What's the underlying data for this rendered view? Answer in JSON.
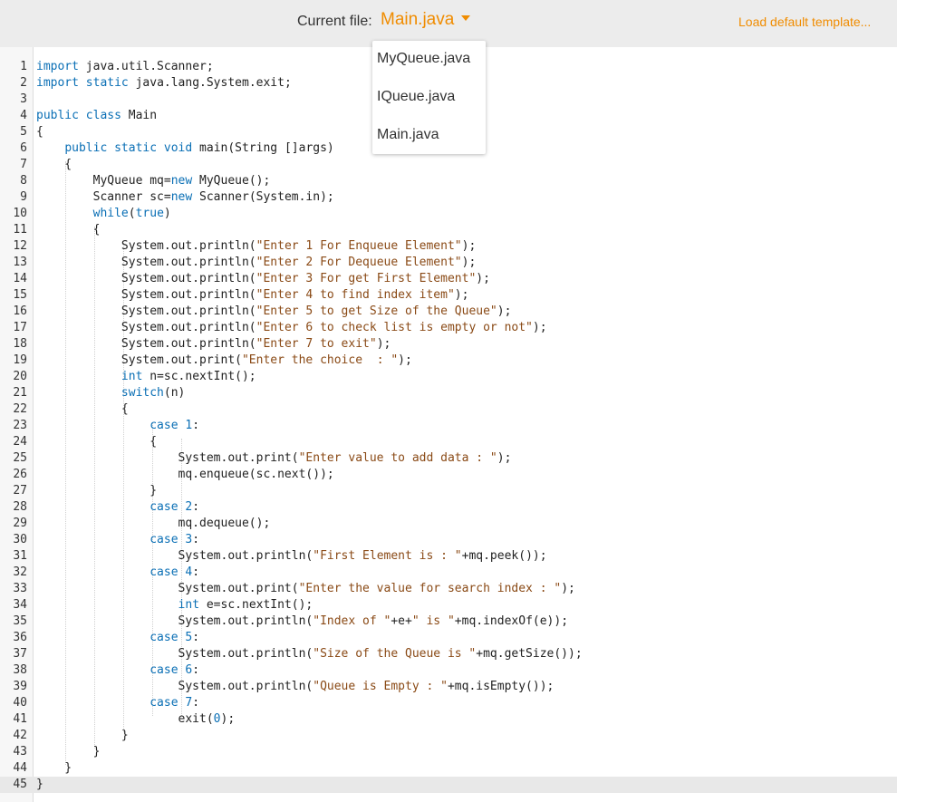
{
  "header": {
    "current_file_label": "Current file:",
    "current_file": "Main.java",
    "load_template": "Load default template..."
  },
  "file_menu": {
    "items": [
      "MyQueue.java",
      "IQueue.java",
      "Main.java"
    ]
  },
  "editor": {
    "active_line": 45,
    "lines": [
      "import java.util.Scanner;",
      "import static java.lang.System.exit;",
      "",
      "public class Main",
      "{",
      "    public static void main(String []args)",
      "    {",
      "        MyQueue mq=new MyQueue();",
      "        Scanner sc=new Scanner(System.in);",
      "        while(true)",
      "        {",
      "            System.out.println(\"Enter 1 For Enqueue Element\");",
      "            System.out.println(\"Enter 2 For Dequeue Element\");",
      "            System.out.println(\"Enter 3 For get First Element\");",
      "            System.out.println(\"Enter 4 to find index item\");",
      "            System.out.println(\"Enter 5 to get Size of the Queue\");",
      "            System.out.println(\"Enter 6 to check list is empty or not\");",
      "            System.out.println(\"Enter 7 to exit\");",
      "            System.out.print(\"Enter the choice  : \");",
      "            int n=sc.nextInt();",
      "            switch(n)",
      "            {",
      "                case 1:",
      "                {",
      "                    System.out.print(\"Enter value to add data : \");",
      "                    mq.enqueue(sc.next());",
      "                }",
      "                case 2:",
      "                    mq.dequeue();",
      "                case 3:",
      "                    System.out.println(\"First Element is : \"+mq.peek());",
      "                case 4:",
      "                    System.out.print(\"Enter the value for search index : \");",
      "                    int e=sc.nextInt();",
      "                    System.out.println(\"Index of \"+e+\" is \"+mq.indexOf(e));",
      "                case 5:",
      "                    System.out.println(\"Size of the Queue is \"+mq.getSize());",
      "                case 6:",
      "                    System.out.println(\"Queue is Empty : \"+mq.isEmpty());",
      "                case 7:",
      "                    exit(0);",
      "            }",
      "        }",
      "    }",
      "}"
    ]
  }
}
